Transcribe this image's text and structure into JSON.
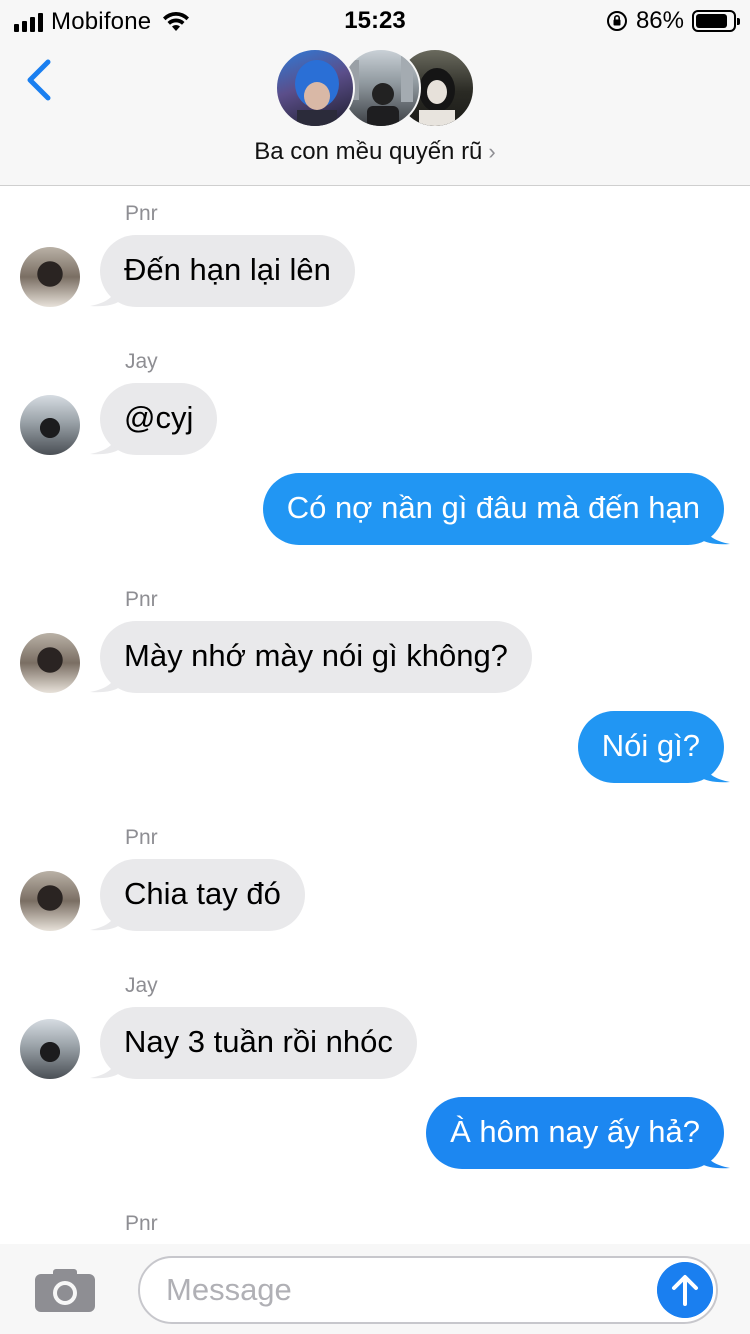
{
  "status_bar": {
    "carrier": "Mobifone",
    "time": "15:23",
    "battery_percent": "86%",
    "battery_level": 0.86
  },
  "header": {
    "back_icon": "chevron-left-icon",
    "group_name": "Ba con mều quyến rũ",
    "chevron": "›"
  },
  "messages": [
    {
      "sender": "Pnr",
      "text": "Đến hạn lại lên"
    },
    {
      "sender": "Jay",
      "text": "@cyj"
    },
    {
      "sender": "me",
      "text": "Có nợ nần gì đâu mà đến hạn"
    },
    {
      "sender": "Pnr",
      "text": "Mày nhớ mày nói gì không?"
    },
    {
      "sender": "me",
      "text": "Nói gì?"
    },
    {
      "sender": "Pnr",
      "text": "Chia tay đó"
    },
    {
      "sender": "Jay",
      "text": "Nay 3 tuần rồi nhóc"
    },
    {
      "sender": "me",
      "text": "À hôm nay ấy hả?"
    },
    {
      "sender": "Pnr",
      "text": ""
    }
  ],
  "composer": {
    "placeholder": "Message",
    "camera_icon": "camera-icon",
    "send_icon": "arrow-up-icon"
  },
  "colors": {
    "incoming_bubble": "#e9e9eb",
    "outgoing_bubble": "#2196f3",
    "accent": "#1a7ff0"
  }
}
